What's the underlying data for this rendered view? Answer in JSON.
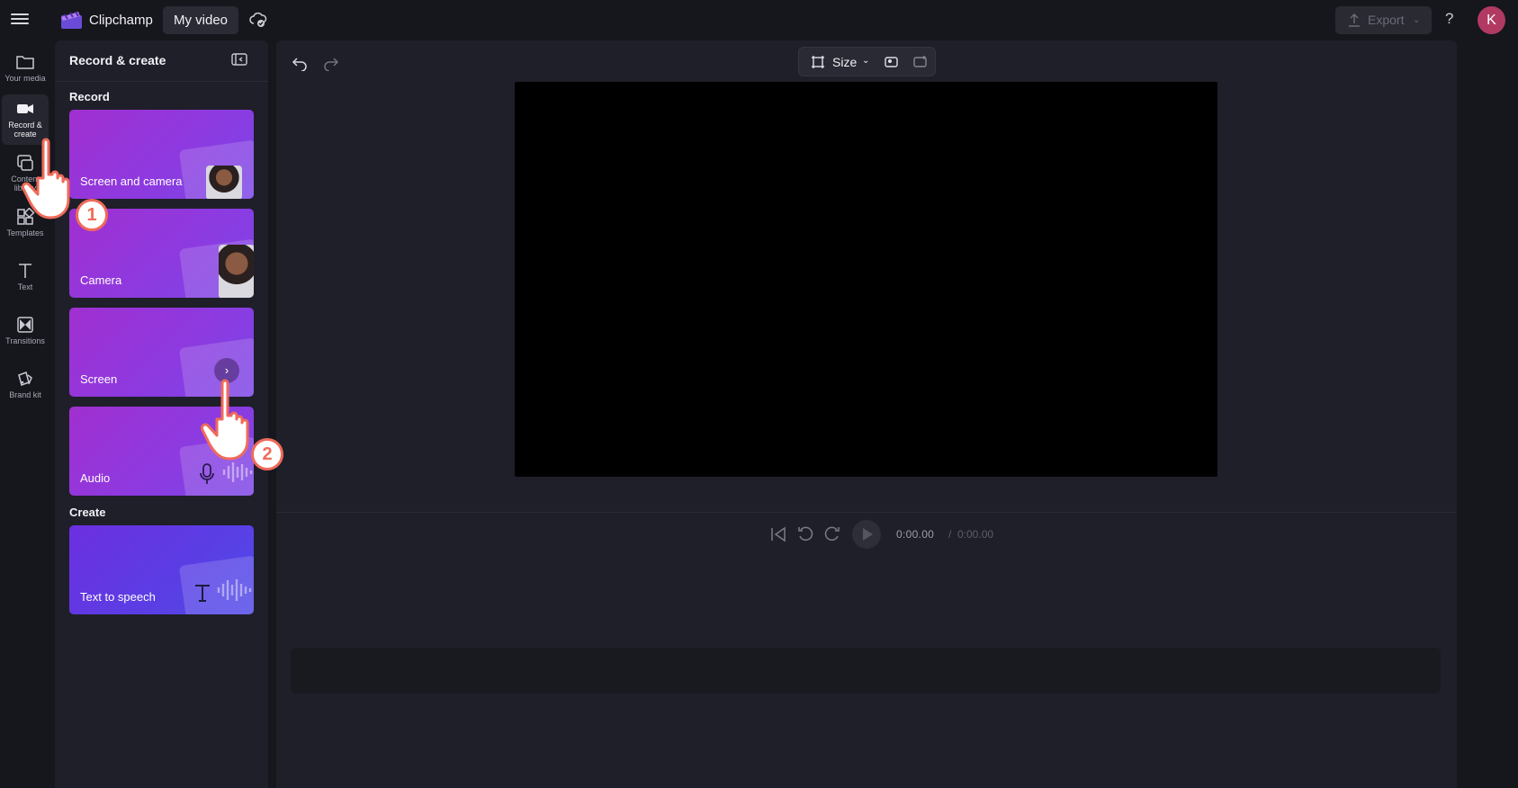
{
  "header": {
    "app_name": "Clipchamp",
    "project_name": "My video",
    "export_label": "Export",
    "help_label": "?",
    "avatar_initial": "K"
  },
  "sidebar": {
    "items": [
      {
        "label": "Your media",
        "icon": "folder-icon"
      },
      {
        "label": "Record & create",
        "icon": "camera-icon",
        "active": true
      },
      {
        "label": "Content library",
        "icon": "content-library-icon"
      },
      {
        "label": "Templates",
        "icon": "templates-icon"
      },
      {
        "label": "Text",
        "icon": "text-icon"
      },
      {
        "label": "Transitions",
        "icon": "transitions-icon"
      },
      {
        "label": "Brand kit",
        "icon": "brand-kit-icon"
      }
    ]
  },
  "panel": {
    "title": "Record & create",
    "record_label": "Record",
    "create_label": "Create",
    "cards": [
      {
        "label": "Screen and camera"
      },
      {
        "label": "Camera"
      },
      {
        "label": "Screen"
      },
      {
        "label": "Audio"
      },
      {
        "label": "Text to speech"
      }
    ]
  },
  "stage": {
    "size_label": "Size",
    "current_time": "0:00.00",
    "separator": "/",
    "total_time": "0:00.00"
  },
  "annotations": {
    "step1": "1",
    "step2": "2"
  },
  "colors": {
    "accent_card": "#8d3ae0",
    "tts_card": "#5b3de4",
    "avatar": "#b13a63",
    "step_badge": "#ef6a5a"
  }
}
